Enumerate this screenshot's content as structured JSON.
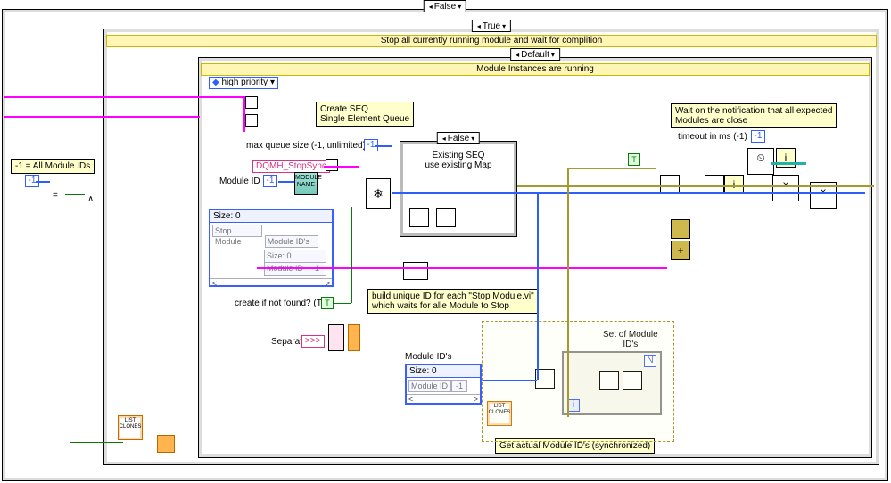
{
  "outer_case": {
    "selector": "False",
    "left_arrow": "◂",
    "right_arrow": "▾"
  },
  "mid_case": {
    "selector": "True",
    "title": "Stop all currently running module and wait for complition"
  },
  "inner_case": {
    "selector": "Default",
    "title": "Module Instances are running"
  },
  "seq_case": {
    "selector": "False",
    "text": "Existing SEQ\nuse existing Map"
  },
  "left_note": "-1 = All Module IDs",
  "const_minus1_left": "-1",
  "high_priority_label": "high priority",
  "tip_create_seq": "Create SEQ\nSingle Element Queue",
  "label_max_queue": "max queue size (-1, unlimited)",
  "const_minus1_queue": "-1",
  "dqmh_stopsync": "DQMH_StopSync",
  "module_id_label": "Module ID",
  "const_minus1_module": "-1",
  "module_name_vi": "MODULE\nNAME",
  "cluster_main": {
    "size_label": "Size: 0",
    "field1_label": "Stop Module",
    "field2_label": "Module ID's",
    "sub_size_label": "Size: 0",
    "sub_field_label": "Module ID",
    "sub_field_value": "-1",
    "scroll_left": "<",
    "scroll_right": ">"
  },
  "create_if_not_found": "create if not found? (T)",
  "const_true": "T",
  "separator_label": "Separator (.)",
  "separator_value": ">>>",
  "tip_build_unique": "build unique ID for each \"Stop Module.vi\"\nwhich waits for alle Module to Stop",
  "module_ids_ctrl": {
    "title": "Module ID's",
    "size_label": "Size: 0",
    "cell_label": "Module ID",
    "cell_value": "-1",
    "scroll_left": "<",
    "scroll_right": ">"
  },
  "tip_wait_notify": "Wait on the notification that all expected\nModules are close",
  "timeout_label": "timeout in ms (-1)",
  "const_minus1_timeout": "-1",
  "const_true_right": "T",
  "set_of_module_ids": "Set of Module\nID's",
  "get_actual_caption": "Get actual Module ID's (synchronized)",
  "list_clones": "LIST\nCLONES",
  "forloop": {
    "N": "N",
    "i": "i"
  },
  "glyphs": {
    "equals": "=",
    "and": "∧",
    "close": "×",
    "plus": "+",
    "info": "i",
    "clock": "⏲",
    "dots": "…"
  }
}
